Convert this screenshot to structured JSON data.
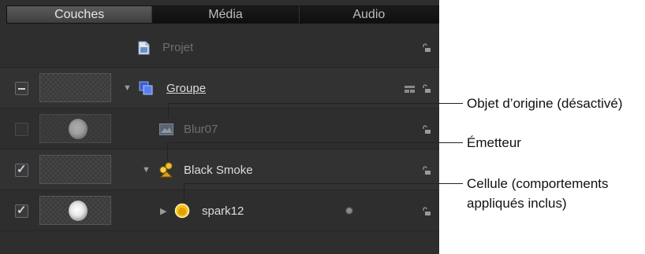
{
  "tabs": [
    "Couches",
    "Média",
    "Audio"
  ],
  "project_label": "Projet",
  "layers": {
    "group": "Groupe",
    "blur": "Blur07",
    "emitter": "Black Smoke",
    "cell": "spark12"
  },
  "callouts": {
    "origin": "Objet d’origine (désactivé)",
    "emitter": "Émetteur",
    "cell_line1": "Cellule (comportements",
    "cell_line2": "appliqués inclus)"
  }
}
